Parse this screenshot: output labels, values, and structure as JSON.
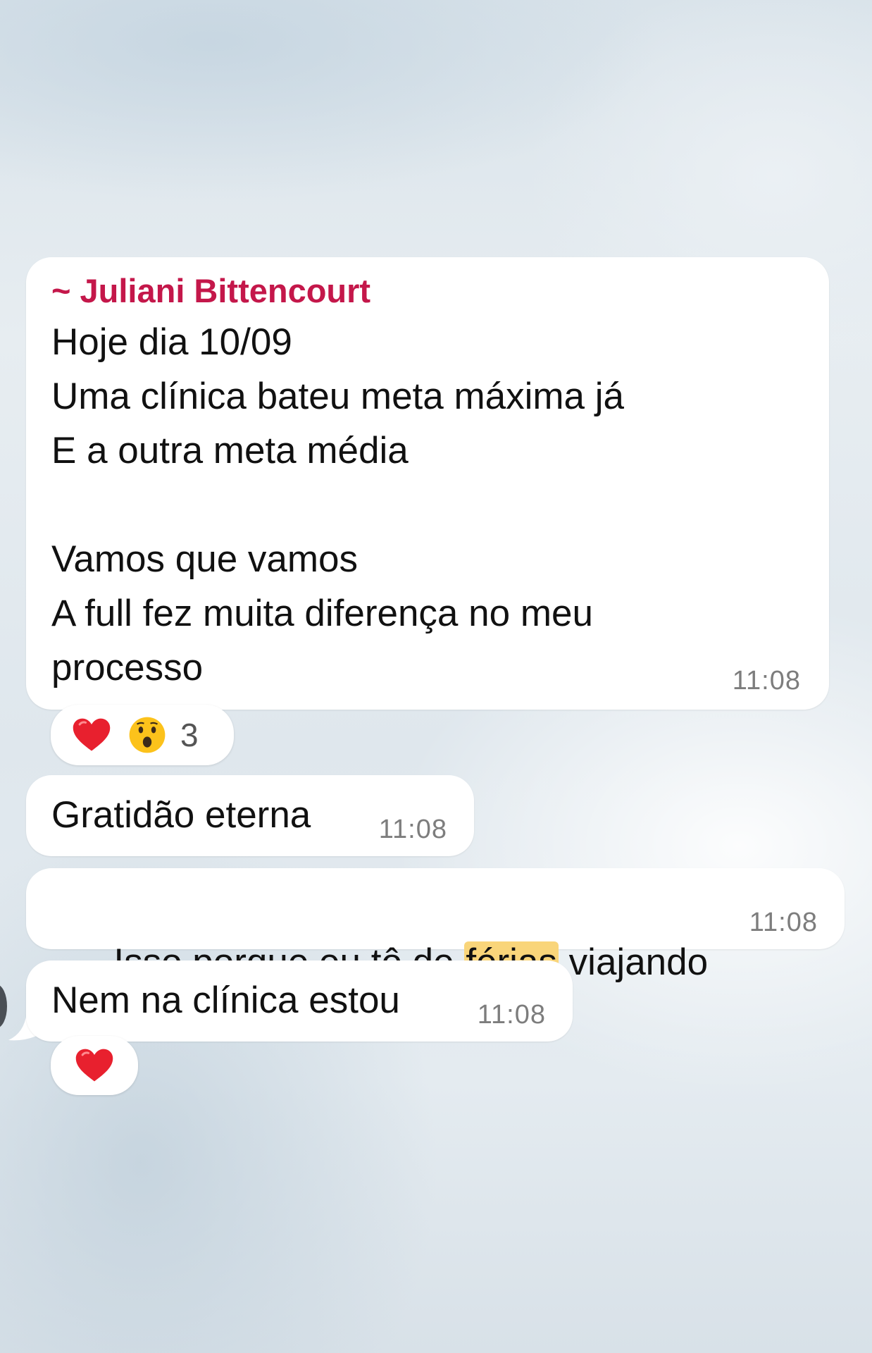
{
  "chat": {
    "messages": [
      {
        "sender": "~ Juliani Bittencourt",
        "text": "Hoje dia 10/09\nUma clínica bateu meta máxima já\nE a outra meta média\n\nVamos que vamos\nA full fez muita diferença no meu\nprocesso",
        "time": "11:08",
        "reactions": {
          "emojis": [
            "heart-icon",
            "surprised-face-icon"
          ],
          "count": "3"
        }
      },
      {
        "text": "Gratidão eterna",
        "time": "11:08"
      },
      {
        "text_before": "Isso porque eu tô de ",
        "text_highlight": "férias",
        "text_after": " viajando",
        "time": "11:08",
        "highlight_color": "#f9d57a"
      },
      {
        "text": "Nem na clínica estou",
        "time": "11:08",
        "reactions": {
          "emojis": [
            "heart-icon"
          ]
        }
      }
    ]
  },
  "colors": {
    "sender_name": "#c4174a",
    "bubble": "#ffffff",
    "timestamp": "#7d7d7d"
  }
}
